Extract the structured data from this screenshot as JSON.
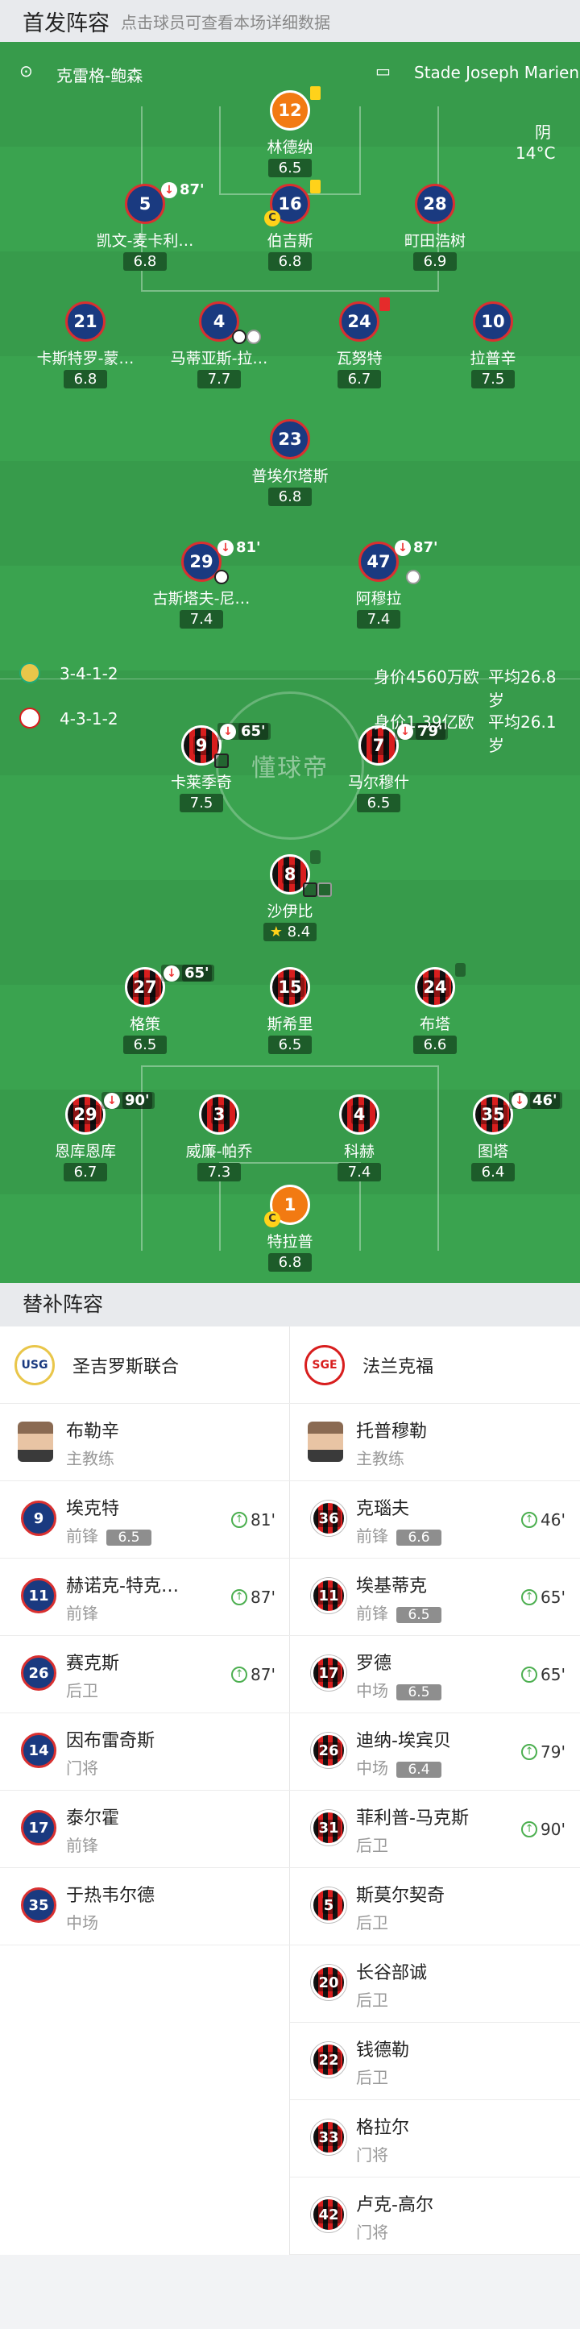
{
  "header": {
    "title": "首发阵容",
    "subtitle": "点击球员可查看本场详细数据"
  },
  "match_info": {
    "coach": "克雷格-鲍森",
    "stadium": "Stade Joseph Marien",
    "weather": "阴",
    "temperature": "14°C"
  },
  "teams": {
    "home": {
      "formation": "3-4-1-2",
      "value": "身价4560万欧",
      "avg_age": "平均26.8岁"
    },
    "away": {
      "formation": "4-3-1-2",
      "value": "身价1.39亿欧",
      "avg_age": "平均26.1岁"
    }
  },
  "home_players": [
    {
      "num": "12",
      "name": "林德纳",
      "rating": "6.5",
      "color": "orange",
      "yellow": true
    },
    {
      "num": "5",
      "name": "凯文-麦卡利…",
      "rating": "6.8",
      "color": "blue",
      "sub": "87'"
    },
    {
      "num": "16",
      "name": "伯吉斯",
      "rating": "6.8",
      "color": "blue",
      "yellow": true,
      "captain": true
    },
    {
      "num": "28",
      "name": "町田浩树",
      "rating": "6.9",
      "color": "blue"
    },
    {
      "num": "21",
      "name": "卡斯特罗-蒙…",
      "rating": "6.8",
      "color": "blue"
    },
    {
      "num": "4",
      "name": "马蒂亚斯-拉…",
      "rating": "7.7",
      "color": "blue",
      "ball": true,
      "boot": true
    },
    {
      "num": "24",
      "name": "瓦努特",
      "rating": "6.7",
      "color": "blue",
      "red": true
    },
    {
      "num": "10",
      "name": "拉普辛",
      "rating": "7.5",
      "color": "blue"
    },
    {
      "num": "23",
      "name": "普埃尔塔斯",
      "rating": "6.8",
      "color": "blue"
    },
    {
      "num": "29",
      "name": "古斯塔夫-尼…",
      "rating": "7.4",
      "color": "blue",
      "sub": "81'",
      "ball": true
    },
    {
      "num": "47",
      "name": "阿穆拉",
      "rating": "7.4",
      "color": "blue",
      "sub": "87'",
      "boot": true
    }
  ],
  "away_players": [
    {
      "num": "9",
      "name": "卡莱季奇",
      "rating": "7.5",
      "sub": "65'",
      "ball": true
    },
    {
      "num": "7",
      "name": "马尔穆什",
      "rating": "6.5",
      "sub": "79'"
    },
    {
      "num": "8",
      "name": "沙伊比",
      "rating": "8.4",
      "yellow": true,
      "ball": true,
      "boot": true,
      "star": true
    },
    {
      "num": "27",
      "name": "格策",
      "rating": "6.5",
      "sub": "65'"
    },
    {
      "num": "15",
      "name": "斯希里",
      "rating": "6.5"
    },
    {
      "num": "24",
      "name": "布塔",
      "rating": "6.6",
      "yellow": true
    },
    {
      "num": "29",
      "name": "恩库恩库",
      "rating": "6.7",
      "sub": "90'"
    },
    {
      "num": "3",
      "name": "威廉-帕乔",
      "rating": "7.3"
    },
    {
      "num": "4",
      "name": "科赫",
      "rating": "7.4"
    },
    {
      "num": "35",
      "name": "图塔",
      "rating": "6.4",
      "yellow": true,
      "sub": "46'"
    },
    {
      "num": "1",
      "name": "特拉普",
      "rating": "6.8",
      "color": "orange",
      "captain": true
    }
  ],
  "subs_section": {
    "title": "替补阵容"
  },
  "home_subs": {
    "team": "圣吉罗斯联合",
    "coach": {
      "name": "布勒辛",
      "role": "主教练"
    },
    "players": [
      {
        "num": "9",
        "name": "埃克特",
        "pos": "前锋",
        "rating": "6.5",
        "on": "81'"
      },
      {
        "num": "11",
        "name": "赫诺克-特克…",
        "pos": "前锋",
        "on": "87'"
      },
      {
        "num": "26",
        "name": "赛克斯",
        "pos": "后卫",
        "on": "87'"
      },
      {
        "num": "14",
        "name": "因布雷奇斯",
        "pos": "门将"
      },
      {
        "num": "17",
        "name": "泰尔霍",
        "pos": "前锋"
      },
      {
        "num": "35",
        "name": "于热韦尔德",
        "pos": "中场"
      }
    ]
  },
  "away_subs": {
    "team": "法兰克福",
    "coach": {
      "name": "托普穆勒",
      "role": "主教练"
    },
    "players": [
      {
        "num": "36",
        "name": "克瑙夫",
        "pos": "前锋",
        "rating": "6.6",
        "on": "46'"
      },
      {
        "num": "11",
        "name": "埃基蒂克",
        "pos": "前锋",
        "rating": "6.5",
        "on": "65'"
      },
      {
        "num": "17",
        "name": "罗德",
        "pos": "中场",
        "rating": "6.5",
        "on": "65'"
      },
      {
        "num": "26",
        "name": "迪纳-埃宾贝",
        "pos": "中场",
        "rating": "6.4",
        "on": "79'"
      },
      {
        "num": "31",
        "name": "菲利普-马克斯",
        "pos": "后卫",
        "on": "90'"
      },
      {
        "num": "5",
        "name": "斯莫尔契奇",
        "pos": "后卫"
      },
      {
        "num": "20",
        "name": "长谷部诚",
        "pos": "后卫"
      },
      {
        "num": "22",
        "name": "钱德勒",
        "pos": "后卫"
      },
      {
        "num": "33",
        "name": "格拉尔",
        "pos": "门将"
      },
      {
        "num": "42",
        "name": "卢克-高尔",
        "pos": "门将"
      }
    ]
  },
  "watermark": "懂球帝",
  "colors": {
    "pitch": "#3aa34f",
    "home": "#1a3a80",
    "away_red": "#d81e1e",
    "keeper": "#f27a12",
    "yellow": "#ffd21a"
  }
}
